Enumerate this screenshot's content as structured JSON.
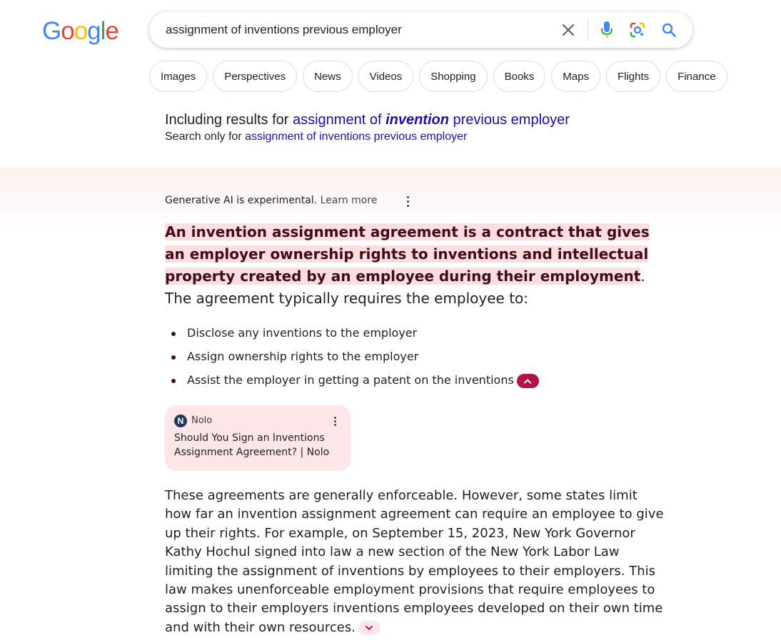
{
  "logo": {
    "letters": [
      "G",
      "o",
      "o",
      "g",
      "l",
      "e"
    ],
    "colors": [
      "#4285F4",
      "#EA4335",
      "#FBBC05",
      "#4285F4",
      "#34A853",
      "#EA4335"
    ]
  },
  "search": {
    "query": "assignment of inventions previous employer",
    "icons": [
      "close-icon",
      "mic-icon",
      "lens-icon",
      "search-icon"
    ]
  },
  "chips": [
    "Images",
    "Perspectives",
    "News",
    "Videos",
    "Shopping",
    "Books",
    "Maps",
    "Flights",
    "Finance"
  ],
  "correction": {
    "including_prefix": "Including results for ",
    "corrected_part1": "assignment of ",
    "corrected_bold": "invention",
    "corrected_part2": " previous employer",
    "search_only_prefix": "Search only for ",
    "original_query": "assignment of inventions previous employer"
  },
  "ai_overview": {
    "disclaimer": "Generative AI is experimental.",
    "learn_more": "Learn more",
    "highlight": "An invention assignment agreement is a contract that gives an employer ownership rights to inventions and intellectual property created by an employee during their employment",
    "summary_rest": ". The agreement typically requires the employee to:",
    "bullets": [
      "Disclose any inventions to the employer",
      "Assign ownership rights to the employer",
      "Assist the employer in getting a patent on the inventions"
    ],
    "source": {
      "logo_letter": "N",
      "name": "Nolo",
      "title": "Should You Sign an Inventions Assignment Agreement? | Nolo"
    },
    "paragraph": "These agreements are generally enforceable. However, some states limit how far an invention assignment agreement can require an employee to give up their rights. For example, on September 15, 2023, New York Governor Kathy Hochul signed into law a new section of the New York Labor Law limiting the assignment of inventions by employees to their employers. This law makes unenforceable employment provisions that require employees to assign to their employers inventions employees developed on their own time and with their own resources."
  },
  "colors": {
    "link": "#1a0dab",
    "highlight_bg": "#fcdde0",
    "accent": "#b3124a",
    "card_bg": "#fde6e8"
  }
}
